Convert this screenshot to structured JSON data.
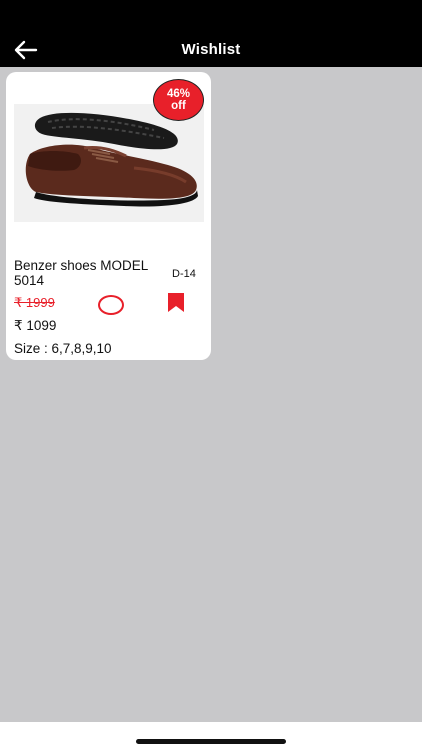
{
  "header": {
    "title": "Wishlist",
    "back_icon": "arrow-left-icon"
  },
  "wishlist": {
    "items": [
      {
        "discount_line1": "46%",
        "discount_line2": "off",
        "name": "Benzer shoes MODEL 5014",
        "code": "D-14",
        "mrp": "₹ 1999",
        "price": "₹ 1099",
        "size": "Size : 6,7,8,9,10",
        "image_icon": "brown-leather-shoe-image",
        "circle_icon": "circle-outline-icon",
        "bookmark_icon": "bookmark-filled-icon"
      }
    ]
  },
  "colors": {
    "header_bg": "#000000",
    "accent": "#e8202a",
    "content_bg": "#c8c8ca"
  }
}
